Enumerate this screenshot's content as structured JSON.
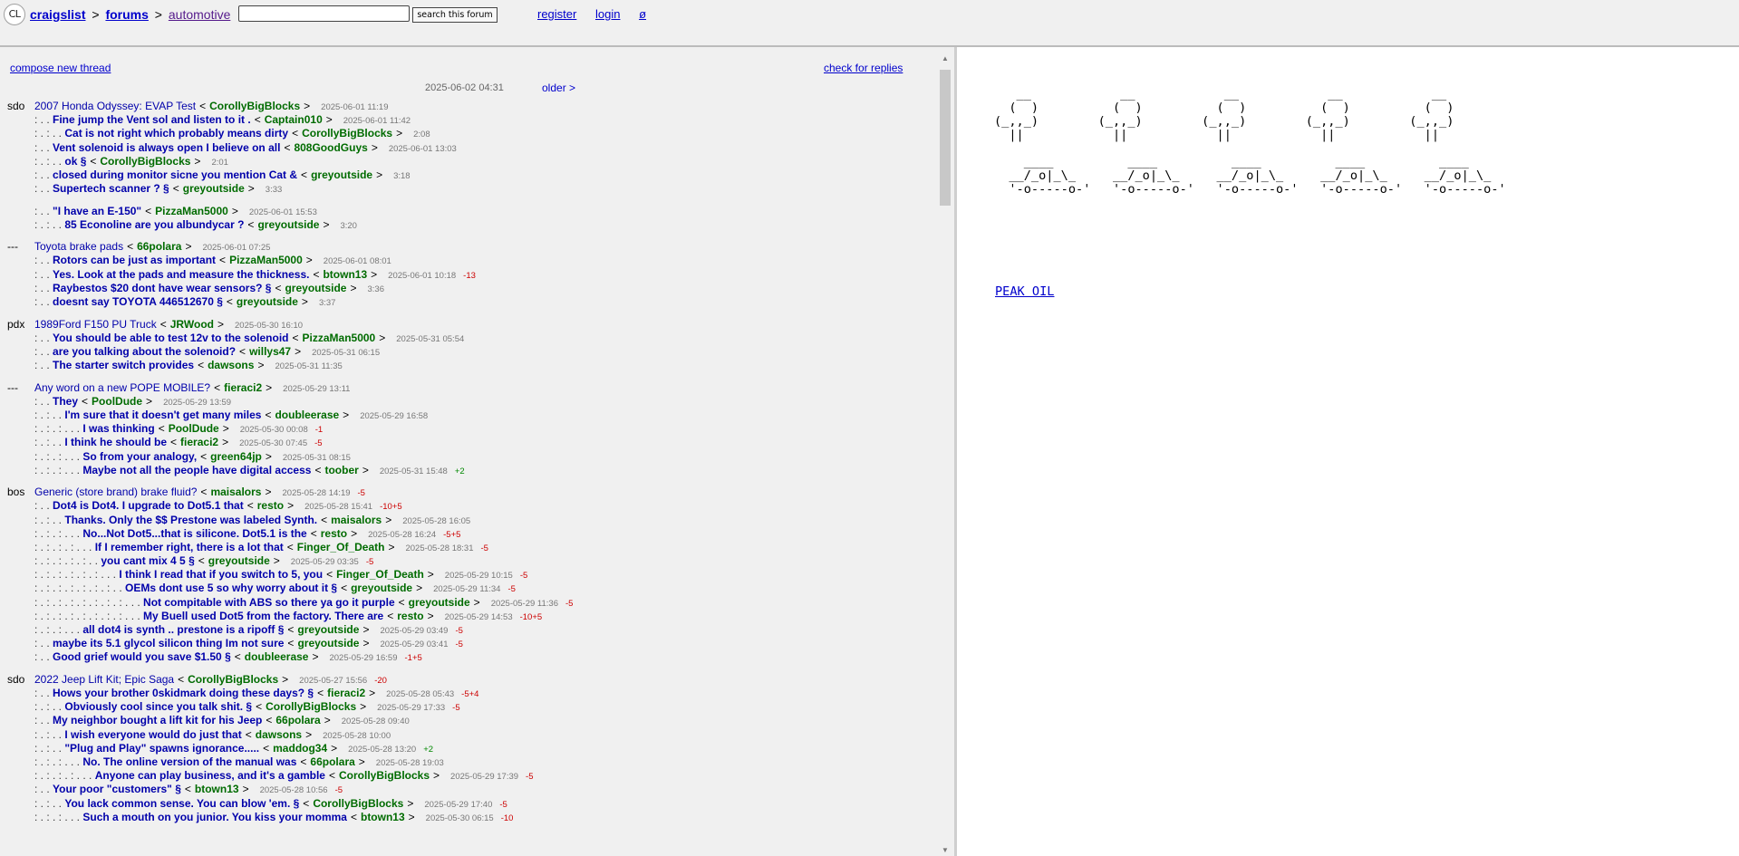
{
  "header": {
    "logo_text": "CL",
    "crumb_home": "craigslist",
    "crumb_sep1": ">",
    "crumb_forums": "forums",
    "crumb_sep2": ">",
    "crumb_current": "automotive",
    "search_value": "",
    "search_button": "search this forum",
    "register": "register",
    "login": "login",
    "settings_glyph": "ø"
  },
  "toolbar": {
    "compose": "compose new thread",
    "check_replies": "check for replies",
    "current_date": "2025-06-02 04:31",
    "older": "older >"
  },
  "threads": [
    {
      "type": "post",
      "site": "sdo",
      "dots": "",
      "subject": "2007 Honda Odyssey: EVAP Test",
      "user": "CorollyBigBlocks",
      "time": "2025-06-01 11:19",
      "score": "",
      "head": true
    },
    {
      "type": "post",
      "dots": ": . .",
      "subject": "Fine jump the Vent sol and listen to it .",
      "user": "Captain010",
      "time": "2025-06-01 11:42",
      "score": ""
    },
    {
      "type": "post",
      "dots": ": . : . .",
      "subject": "Cat is not right which probably means dirty",
      "user": "CorollyBigBlocks",
      "time": "2:08",
      "score": ""
    },
    {
      "type": "post",
      "dots": ": . .",
      "subject": "Vent solenoid is always open I believe on all",
      "user": "808GoodGuys",
      "time": "2025-06-01 13:03",
      "score": ""
    },
    {
      "type": "post",
      "dots": ": . : . .",
      "subject": "ok §",
      "user": "CorollyBigBlocks",
      "time": "2:01",
      "score": ""
    },
    {
      "type": "post",
      "dots": ": . .",
      "subject": "closed during monitor sicne you mention Cat &",
      "user": "greyoutside",
      "time": "3:18",
      "score": ""
    },
    {
      "type": "post",
      "dots": ": . .",
      "subject": "Supertech scanner ? §",
      "user": "greyoutside",
      "time": "3:33",
      "score": ""
    },
    {
      "type": "gap"
    },
    {
      "type": "post",
      "dots": ": . .",
      "subject": "\"I have an E-150\"",
      "user": "PizzaMan5000",
      "time": "2025-06-01 15:53",
      "score": ""
    },
    {
      "type": "post",
      "dots": ": . : . .",
      "subject": "85 Econoline are you albundycar ?",
      "user": "greyoutside",
      "time": "3:20",
      "score": ""
    },
    {
      "type": "gap"
    },
    {
      "type": "post",
      "site": "---",
      "dots": "",
      "subject": "Toyota brake pads",
      "user": "66polara",
      "time": "2025-06-01 07:25",
      "score": "",
      "head": true
    },
    {
      "type": "post",
      "dots": ": . .",
      "subject": "Rotors can be just as important",
      "user": "PizzaMan5000",
      "time": "2025-06-01 08:01",
      "score": ""
    },
    {
      "type": "post",
      "dots": ": . .",
      "subject": "Yes. Look at the pads and measure the thickness.",
      "user": "btown13",
      "time": "2025-06-01 10:18",
      "score": "-13"
    },
    {
      "type": "post",
      "dots": ": . .",
      "subject": "Raybestos $20 dont have wear sensors? §",
      "user": "greyoutside",
      "time": "3:36",
      "score": ""
    },
    {
      "type": "post",
      "dots": ": . .",
      "subject": "doesnt say TOYOTA 446512670 §",
      "user": "greyoutside",
      "time": "3:37",
      "score": ""
    },
    {
      "type": "gap"
    },
    {
      "type": "post",
      "site": "pdx",
      "dots": "",
      "subject": "1989Ford F150 PU Truck",
      "user": "JRWood",
      "time": "2025-05-30 16:10",
      "score": "",
      "head": true
    },
    {
      "type": "post",
      "dots": ": . .",
      "subject": "You should be able to test 12v to the solenoid",
      "user": "PizzaMan5000",
      "time": "2025-05-31 05:54",
      "score": ""
    },
    {
      "type": "post",
      "dots": ": . .",
      "subject": "are you talking about the solenoid?",
      "user": "willys47",
      "time": "2025-05-31 06:15",
      "score": ""
    },
    {
      "type": "post",
      "dots": ": . .",
      "subject": "The starter switch provides",
      "user": "dawsons",
      "time": "2025-05-31 11:35",
      "score": ""
    },
    {
      "type": "gap"
    },
    {
      "type": "post",
      "site": "---",
      "dots": "",
      "subject": "Any word on a new POPE MOBILE?",
      "user": "fieraci2",
      "time": "2025-05-29 13:11",
      "score": "",
      "head": true
    },
    {
      "type": "post",
      "dots": ": . .",
      "subject": "They",
      "user": "PoolDude",
      "time": "2025-05-29 13:59",
      "score": ""
    },
    {
      "type": "post",
      "dots": ": . : . .",
      "subject": "I'm sure that it doesn't get many miles",
      "user": "doubleerase",
      "time": "2025-05-29 16:58",
      "score": ""
    },
    {
      "type": "post",
      "dots": ": . : . : . . .",
      "subject": "I was thinking",
      "user": "PoolDude",
      "time": "2025-05-30 00:08",
      "score": "-1"
    },
    {
      "type": "post",
      "dots": ": . : . .",
      "subject": "I think he should be",
      "user": "fieraci2",
      "time": "2025-05-30 07:45",
      "score": "-5"
    },
    {
      "type": "post",
      "dots": ": . : . : . . .",
      "subject": "So from your analogy,",
      "user": "green64jp",
      "time": "2025-05-31 08:15",
      "score": ""
    },
    {
      "type": "post",
      "dots": ": . : . : . . .",
      "subject": "Maybe not all the people have digital access",
      "user": "toober",
      "time": "2025-05-31 15:48",
      "score": "+2"
    },
    {
      "type": "gap"
    },
    {
      "type": "post",
      "site": "bos",
      "dots": "",
      "subject": "Generic (store brand) brake fluid?",
      "user": "maisalors",
      "time": "2025-05-28 14:19",
      "score": "-5",
      "head": true
    },
    {
      "type": "post",
      "dots": ": . .",
      "subject": "Dot4 is Dot4. I upgrade to Dot5.1 that",
      "user": "resto",
      "time": "2025-05-28 15:41",
      "score": "-10+5"
    },
    {
      "type": "post",
      "dots": ": . : . .",
      "subject": "Thanks. Only the $$ Prestone was labeled Synth.",
      "user": "maisalors",
      "time": "2025-05-28 16:05",
      "score": ""
    },
    {
      "type": "post",
      "dots": ": . : . : . . .",
      "subject": "No...Not Dot5...that is silicone. Dot5.1 is the",
      "user": "resto",
      "time": "2025-05-28 16:24",
      "score": "-5+5"
    },
    {
      "type": "post",
      "dots": ": . : . : . : . . .",
      "subject": "If I remember right, there is a lot that",
      "user": "Finger_Of_Death",
      "time": "2025-05-28 18:31",
      "score": "-5"
    },
    {
      "type": "post",
      "dots": ": . : . : . : . : . .",
      "subject": "you cant mix 4 5 §",
      "user": "greyoutside",
      "time": "2025-05-29 03:35",
      "score": "-5"
    },
    {
      "type": "post",
      "dots": ": . : . : . : . : . : . . .",
      "subject": "I think I read that if you switch to 5, you",
      "user": "Finger_Of_Death",
      "time": "2025-05-29 10:15",
      "score": "-5"
    },
    {
      "type": "post",
      "dots": ": . : . : . : . : . : . : . .",
      "subject": "OEMs dont use 5 so why worry about it §",
      "user": "greyoutside",
      "time": "2025-05-29 11:34",
      "score": "-5"
    },
    {
      "type": "post",
      "dots": ": . : . : . : . : . : . : . : . . .",
      "subject": "Not compitable with ABS so there ya go it purple",
      "user": "greyoutside",
      "time": "2025-05-29 11:36",
      "score": "-5"
    },
    {
      "type": "post",
      "dots": ": . : . : . : . : . : . : . : . . .",
      "subject": "My Buell used Dot5 from the factory. There are",
      "user": "resto",
      "time": "2025-05-29 14:53",
      "score": "-10+5"
    },
    {
      "type": "post",
      "dots": ": . : . : . . .",
      "subject": "all dot4 is synth .. prestone is a ripoff §",
      "user": "greyoutside",
      "time": "2025-05-29 03:49",
      "score": "-5"
    },
    {
      "type": "post",
      "dots": ": . .",
      "subject": "maybe its 5.1 glycol silicon thing Im not sure",
      "user": "greyoutside",
      "time": "2025-05-29 03:41",
      "score": "-5"
    },
    {
      "type": "post",
      "dots": ": . .",
      "subject": "Good grief would you save $1.50 §",
      "user": "doubleerase",
      "time": "2025-05-29 16:59",
      "score": "-1+5"
    },
    {
      "type": "gap"
    },
    {
      "type": "post",
      "site": "sdo",
      "dots": "",
      "subject": "2022 Jeep Lift Kit; Epic Saga",
      "user": "CorollyBigBlocks",
      "time": "2025-05-27 15:56",
      "score": "-20",
      "head": true
    },
    {
      "type": "post",
      "dots": ": . .",
      "subject": "Hows your brother 0skidmark doing these days? §",
      "user": "fieraci2",
      "time": "2025-05-28 05:43",
      "score": "-5+4"
    },
    {
      "type": "post",
      "dots": ": . : . .",
      "subject": "Obviously cool since you talk shit. §",
      "user": "CorollyBigBlocks",
      "time": "2025-05-29 17:33",
      "score": "-5"
    },
    {
      "type": "post",
      "dots": ": . .",
      "subject": "My neighbor bought a lift kit for his Jeep",
      "user": "66polara",
      "time": "2025-05-28 09:40",
      "score": ""
    },
    {
      "type": "post",
      "dots": ": . : . .",
      "subject": "I wish everyone would do just that",
      "user": "dawsons",
      "time": "2025-05-28 10:00",
      "score": ""
    },
    {
      "type": "post",
      "dots": ": . : . .",
      "subject": "\"Plug and Play\" spawns ignorance.....",
      "user": "maddog34",
      "time": "2025-05-28 13:20",
      "score": "+2"
    },
    {
      "type": "post",
      "dots": ": . : . : . . .",
      "subject": "No. The online version of the manual was",
      "user": "66polara",
      "time": "2025-05-28 19:03",
      "score": ""
    },
    {
      "type": "post",
      "dots": ": . : . : . : . . .",
      "subject": "Anyone can play business, and it's a gamble",
      "user": "CorollyBigBlocks",
      "time": "2025-05-29 17:39",
      "score": "-5"
    },
    {
      "type": "post",
      "dots": ": . .",
      "subject": "Your poor \"customers\" §",
      "user": "btown13",
      "time": "2025-05-28 10:56",
      "score": "-5"
    },
    {
      "type": "post",
      "dots": ": . : . .",
      "subject": "You lack common sense. You can blow 'em. §",
      "user": "CorollyBigBlocks",
      "time": "2025-05-29 17:40",
      "score": "-5"
    },
    {
      "type": "post",
      "dots": ": . : . : . . .",
      "subject": "Such a mouth on you junior. You kiss your momma",
      "user": "btown13",
      "time": "2025-05-30 06:15",
      "score": "-10"
    }
  ],
  "right": {
    "ascii_art": "   __            __            __            __            __\n  (  )          (  )          (  )          (  )          (  )\n(_,,_)        (_,,_)        (_,,_)        (_,,_)        (_,,_)\n  ||            ||            ||            ||            ||\n\n    ____          ____          ____          ____          ____\n  __/_o|_\\_     __/_o|_\\_     __/_o|_\\_     __/_o|_\\_     __/_o|_\\_\n  '-o-----o-'   '-o-----o-'   '-o-----o-'   '-o-----o-'   '-o-----o-'",
    "peak_oil": "PEAK OIL"
  },
  "colors": {
    "link": "#0000cc",
    "username": "#006b00",
    "negative_score": "#cc0000",
    "positive_score": "#008800"
  }
}
